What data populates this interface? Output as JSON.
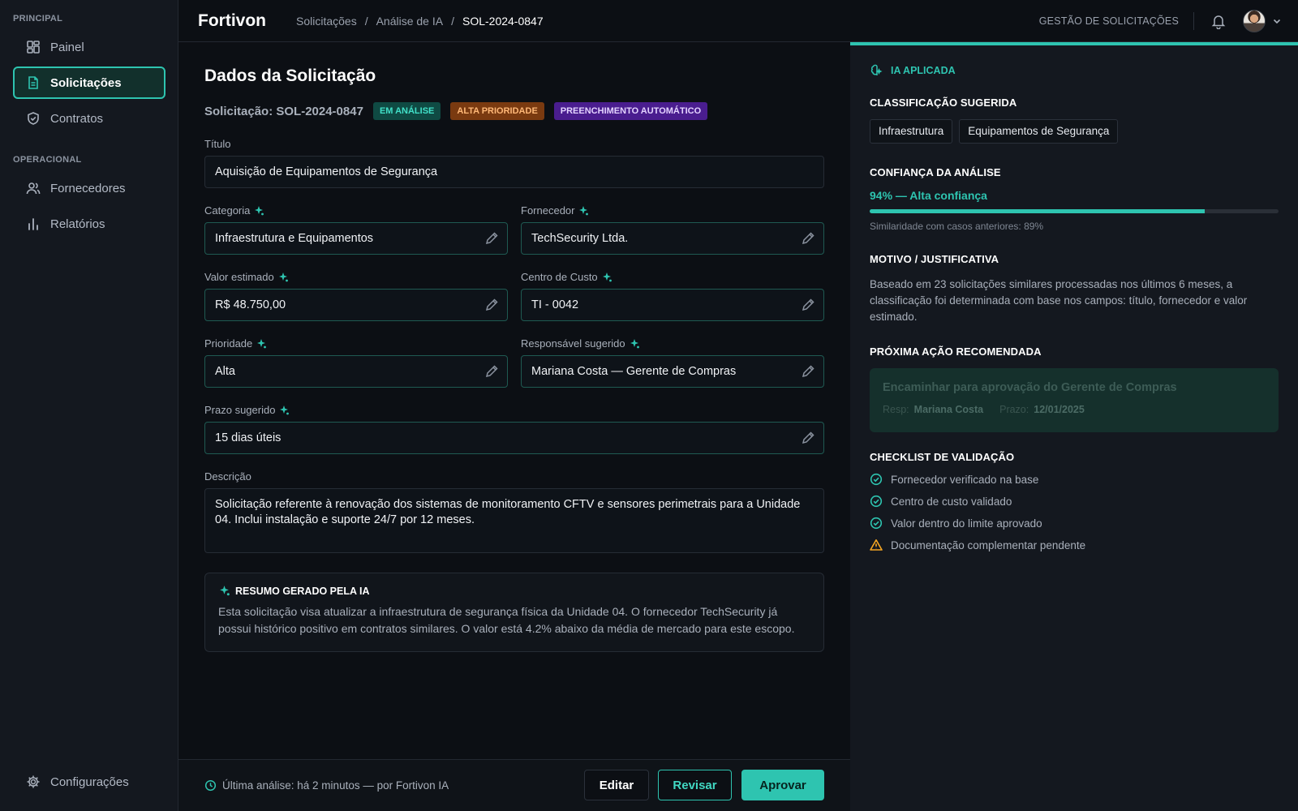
{
  "sidebar": {
    "section_principal": "PRINCIPAL",
    "section_operacional": "OPERACIONAL",
    "items": [
      {
        "label": "Painel",
        "icon": "dashboard-icon"
      },
      {
        "label": "Solicitações",
        "icon": "document-icon",
        "active": true
      },
      {
        "label": "Contratos",
        "icon": "shield-icon"
      },
      {
        "label": "Fornecedores",
        "icon": "users-icon"
      },
      {
        "label": "Relatórios",
        "icon": "bar-chart-icon"
      }
    ],
    "settings_label": "Configurações"
  },
  "header": {
    "logo": "Fortivon",
    "breadcrumb": [
      "Solicitações",
      "Análise de IA",
      "SOL-2024-0847"
    ],
    "breadcrumb_sep": "/",
    "title": "GESTÃO DE SOLICITAÇÕES"
  },
  "form": {
    "heading": "Dados da Solicitação",
    "request_id": "Solicitação: SOL-2024-0847",
    "badges": [
      "EM ANÁLISE",
      "ALTA PRIORIDADE",
      "PREENCHIMENTO AUTOMÁTICO"
    ],
    "title_label": "Título",
    "title_value": "Aquisição de Equipamentos de Segurança",
    "category_label": "Categoria",
    "category_value": "Infraestrutura e Equipamentos",
    "supplier_label": "Fornecedor",
    "supplier_value": "TechSecurity Ltda.",
    "value_label": "Valor estimado",
    "value_value": "R$ 48.750,00",
    "cost_center_label": "Centro de Custo",
    "cost_center_value": "TI - 0042",
    "priority_label": "Prioridade",
    "priority_value": "Alta",
    "owner_label": "Responsável sugerido",
    "owner_value": "Mariana Costa — Gerente de Compras",
    "deadline_label": "Prazo sugerido",
    "deadline_value": "15 dias úteis",
    "description_label": "Descrição",
    "description_value": "Solicitação referente à renovação dos sistemas de monitoramento CFTV e sensores perimetrais para a Unidade 04. Inclui instalação e suporte 24/7 por 12 meses."
  },
  "summary": {
    "title": "RESUMO GERADO PELA IA",
    "body": "Esta solicitação visa atualizar a infraestrutura de segurança física da Unidade 04. O fornecedor TechSecurity já possui histórico positivo em contratos similares. O valor está 4.2% abaixo da média de mercado para este escopo."
  },
  "footer": {
    "status": "Última análise: há 2 minutos — por Fortivon IA",
    "edit_label": "Editar",
    "review_label": "Revisar",
    "approve_label": "Aprovar"
  },
  "ai_panel": {
    "tag": "IA APLICADA",
    "classification_title": "CLASSIFICAÇÃO SUGERIDA",
    "chips": [
      "Infraestrutura",
      "Equipamentos de Segurança"
    ],
    "confidence_title": "CONFIANÇA DA ANÁLISE",
    "confidence_text": "94% — Alta confiança",
    "confidence_value": 0.82,
    "similarity": "Similaridade com casos anteriores: 89%",
    "reason_title": "MOTIVO / JUSTIFICATIVA",
    "reason_text": "Baseado em 23 solicitações similares processadas nos últimos 6 meses, a classificação foi determinada com base nos campos: título, fornecedor e valor estimado.",
    "next_title": "PRÓXIMA AÇÃO RECOMENDADA",
    "next_action": "Encaminhar para aprovação do Gerente de Compras",
    "next_resp_label": "Resp:",
    "next_resp": "Mariana Costa",
    "next_due_label": "Prazo:",
    "next_due": "12/01/2025",
    "checklist_title": "CHECKLIST DE VALIDAÇÃO",
    "checklist": [
      {
        "label": "Fornecedor verificado na base",
        "status": "ok"
      },
      {
        "label": "Centro de custo validado",
        "status": "ok"
      },
      {
        "label": "Valor dentro do limite aprovado",
        "status": "ok"
      },
      {
        "label": "Documentação complementar pendente",
        "status": "warning"
      }
    ]
  },
  "colors": {
    "accent": "#2ec4b0",
    "warning": "#f5a623",
    "background": "#0c0f14"
  }
}
